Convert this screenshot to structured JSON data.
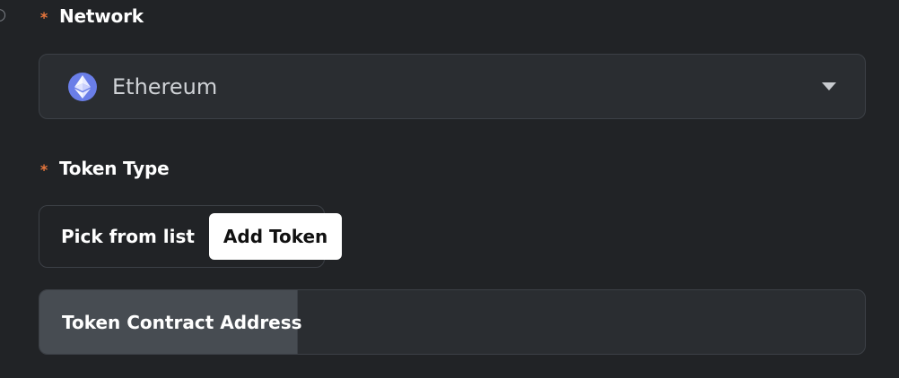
{
  "network": {
    "required_mark": "*",
    "label": "Network",
    "selected": "Ethereum",
    "icon": "ethereum-icon"
  },
  "token_type": {
    "required_mark": "*",
    "label": "Token Type",
    "options": [
      "Pick from list",
      "Add Token"
    ],
    "selected": "Add Token"
  },
  "contract_address": {
    "label": "Token Contract Address",
    "value": "",
    "placeholder": ""
  },
  "colors": {
    "background": "#212326",
    "field": "#2a2d31",
    "border": "#3c4046",
    "addon": "#474c52",
    "required": "#e8763c",
    "ethereum": "#6a7ee8",
    "selected_option_bg": "#ffffff"
  }
}
